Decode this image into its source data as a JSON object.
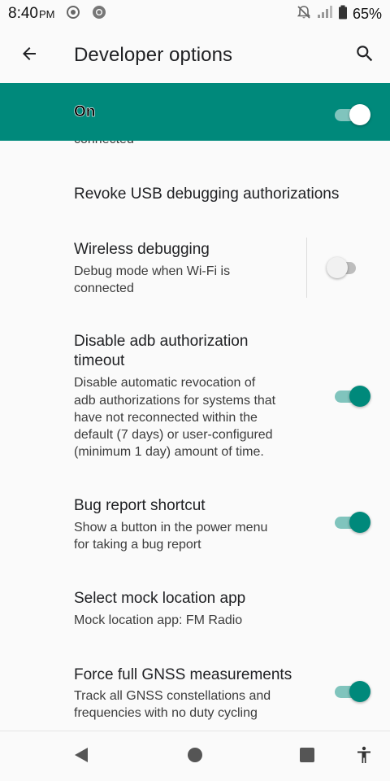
{
  "status_bar": {
    "time": "8:40",
    "ampm": "PM",
    "battery_percent": "65%",
    "icons": [
      "screen-record-icon",
      "chrome-icon",
      "notifications-off-icon",
      "signal-icon",
      "battery-icon"
    ]
  },
  "app_bar": {
    "title": "Developer options",
    "back_icon": "arrow-back-icon",
    "search_icon": "search-icon"
  },
  "master_switch": {
    "label": "On",
    "checked": true
  },
  "list": {
    "partial_summary": "connected",
    "items": [
      {
        "title": "Revoke USB debugging authorizations"
      },
      {
        "title": "Wireless debugging",
        "summary_lines": [
          "Debug mode when Wi-Fi is",
          "connected"
        ],
        "checked": false
      },
      {
        "title_lines": [
          "Disable adb authorization",
          "timeout"
        ],
        "summary_lines": [
          "Disable automatic revocation of",
          "adb authorizations for systems that",
          "have not reconnected within the",
          "default (7 days) or user-configured",
          "(minimum 1 day) amount of time."
        ],
        "checked": true
      },
      {
        "title": "Bug report shortcut",
        "summary_lines": [
          "Show a button in the power menu",
          "for taking a bug report"
        ],
        "checked": true
      },
      {
        "title": "Select mock location app",
        "summary_lines": [
          "Mock location app: FM Radio"
        ]
      },
      {
        "title": "Force full GNSS measurements",
        "summary_lines": [
          "Track all GNSS constellations and",
          "frequencies with no duty cycling"
        ],
        "checked": true
      }
    ]
  },
  "nav_bar": {
    "icons": [
      "nav-back-icon",
      "nav-home-icon",
      "nav-recents-icon",
      "accessibility-icon"
    ]
  },
  "colors": {
    "accent": "#00897b",
    "accent_track": "#80c4bd"
  }
}
